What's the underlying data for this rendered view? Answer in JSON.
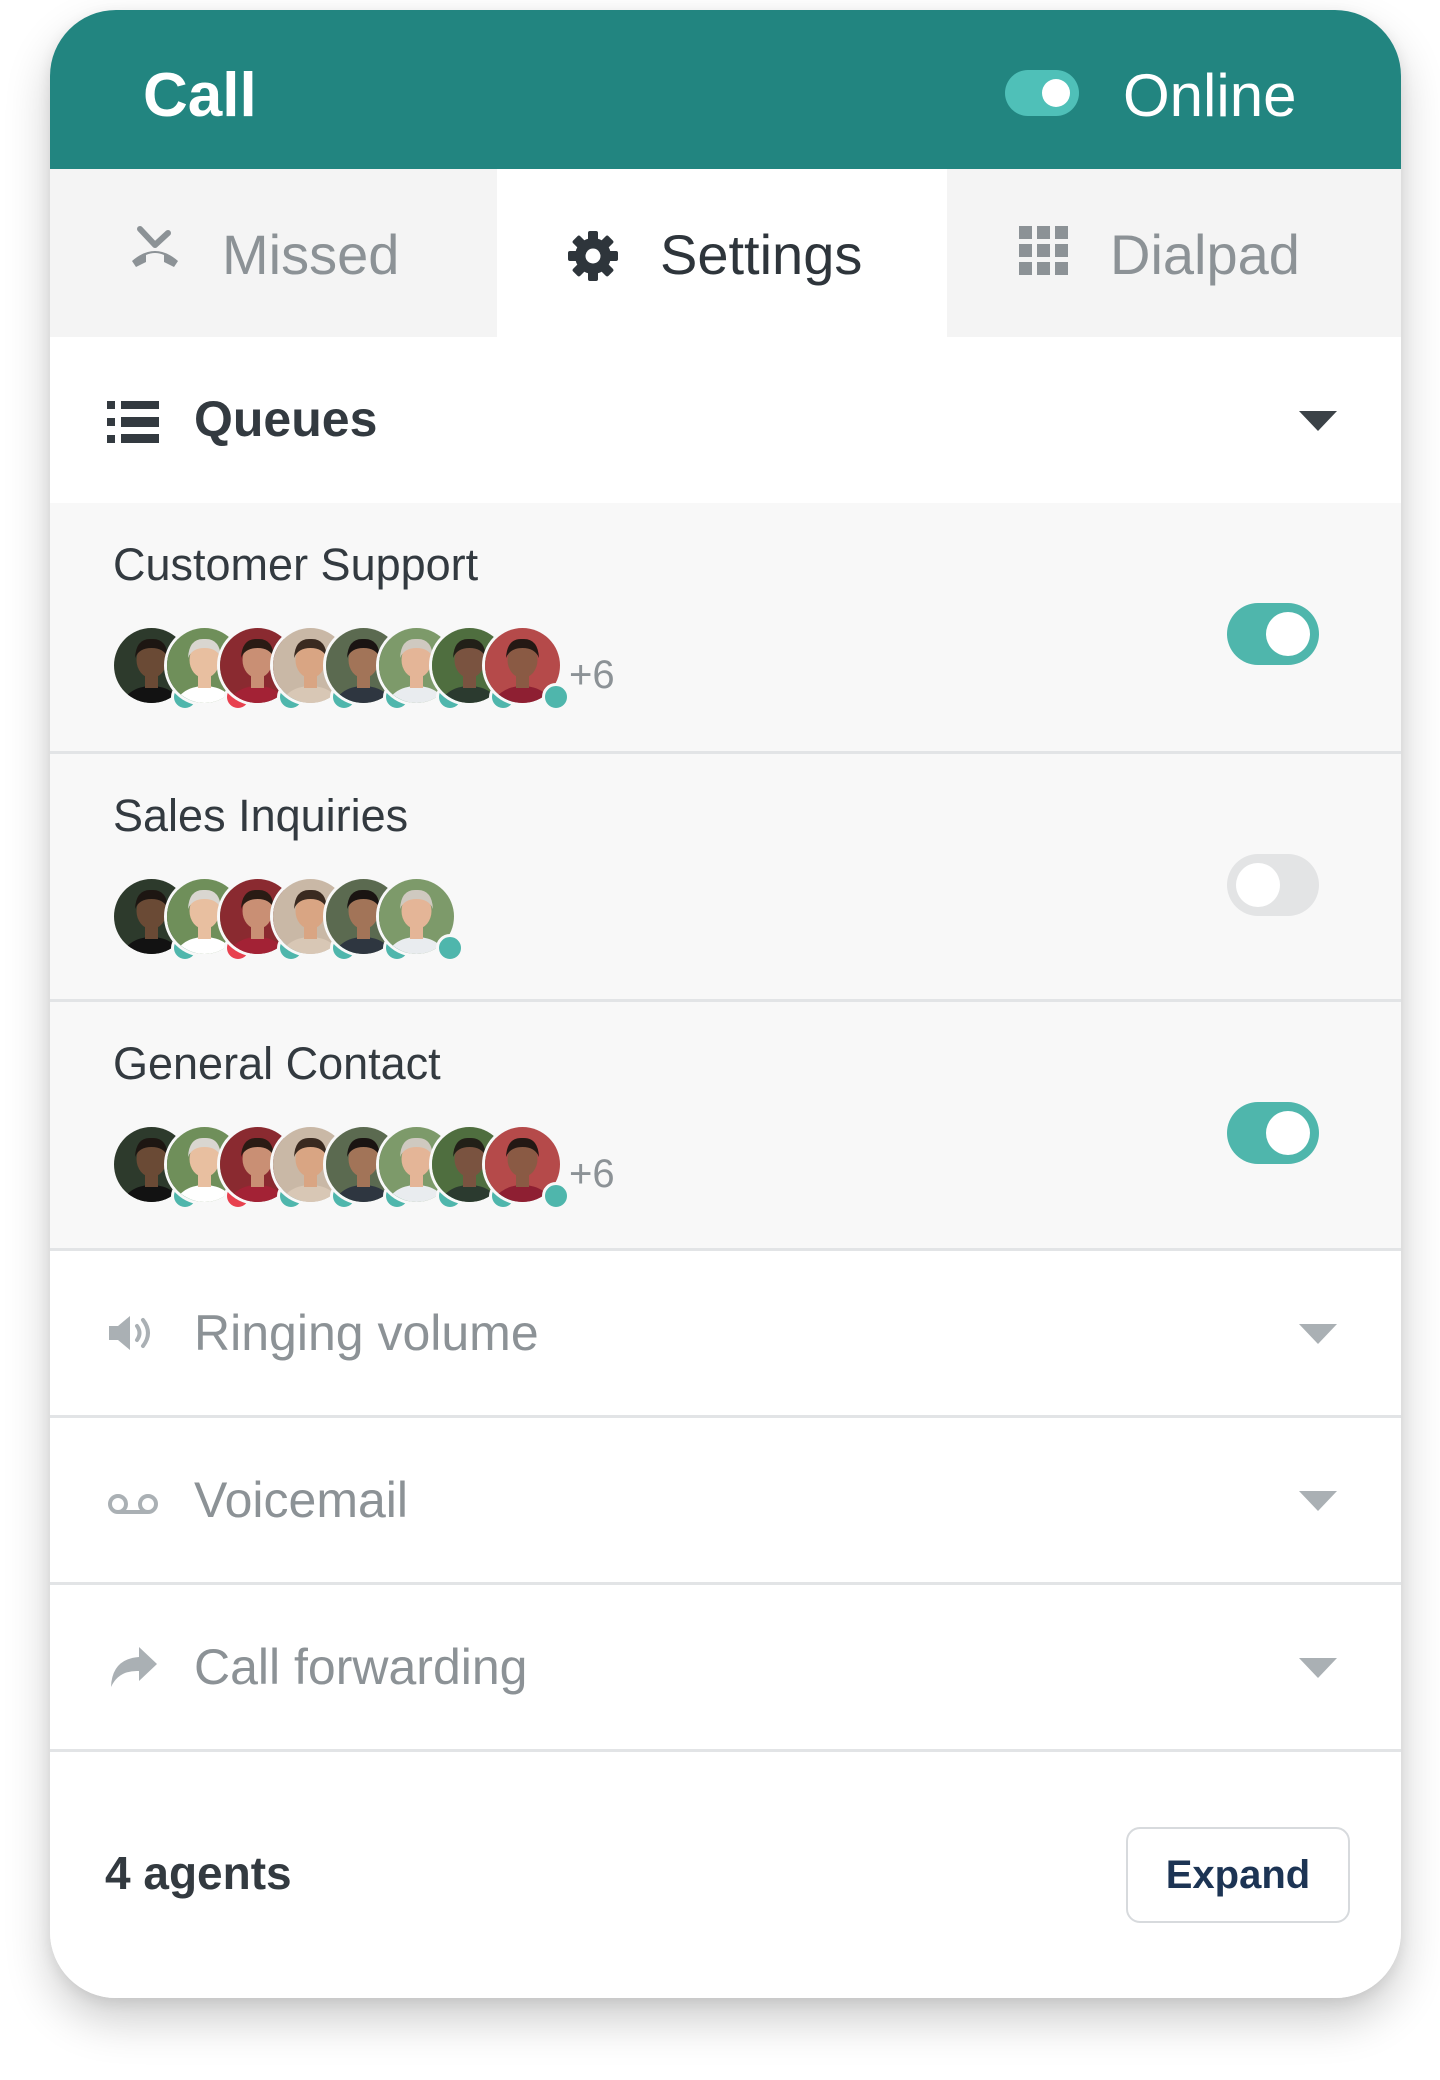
{
  "header": {
    "title": "Call",
    "status_label": "Online",
    "status_on": true
  },
  "tabs": [
    {
      "label": "Missed",
      "icon": "missed-call-icon",
      "active": false
    },
    {
      "label": "Settings",
      "icon": "gear-icon",
      "active": true
    },
    {
      "label": "Dialpad",
      "icon": "dialpad-icon",
      "active": false
    }
  ],
  "queues": {
    "label": "Queues",
    "icon": "list-icon",
    "items": [
      {
        "name": "Customer Support",
        "enabled": true,
        "extra_agents": "+6",
        "agent_status": [
          "online",
          "busy",
          "online",
          "online",
          "online",
          "online",
          "online",
          "online"
        ]
      },
      {
        "name": "Sales Inquiries",
        "enabled": false,
        "extra_agents": "",
        "agent_status": [
          "online",
          "busy",
          "online",
          "online",
          "online",
          "online"
        ]
      },
      {
        "name": "General Contact",
        "enabled": true,
        "extra_agents": "+6",
        "agent_status": [
          "online",
          "busy",
          "online",
          "online",
          "online",
          "online",
          "online",
          "online"
        ]
      }
    ]
  },
  "sections": [
    {
      "label": "Ringing volume",
      "icon": "speaker-icon"
    },
    {
      "label": "Voicemail",
      "icon": "voicemail-icon"
    },
    {
      "label": "Call forwarding",
      "icon": "forward-icon"
    }
  ],
  "footer": {
    "agents_label": "4 agents",
    "expand_label": "Expand"
  },
  "colors": {
    "header": "#228580",
    "toggle_on": "#4fb6ac",
    "toggle_off": "#e3e4e5",
    "status_online": "#4fb6ac",
    "status_busy": "#e8414f"
  }
}
